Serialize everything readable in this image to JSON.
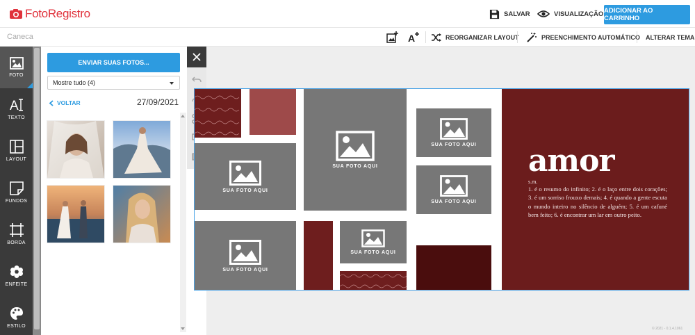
{
  "header": {
    "logo_text": "FotoRegistro",
    "save_label": "SALVAR",
    "preview_label": "VISUALIZAÇÃO",
    "cart_label": "ADICIONAR AO CARRINHO"
  },
  "subbar": {
    "product_name": "Caneca",
    "reorganize_label": "REORGANIZAR LAYOUT",
    "autofill_label": "PREENCHIMENTO AUTOMÁTICO",
    "change_theme_label": "ALTERAR TEMA"
  },
  "tools": [
    {
      "label": "FOTO",
      "icon": "image-icon",
      "active": true
    },
    {
      "label": "TEXTO",
      "icon": "text-icon"
    },
    {
      "label": "LAYOUT",
      "icon": "layout-icon"
    },
    {
      "label": "FUNDOS",
      "icon": "background-icon"
    },
    {
      "label": "BORDA",
      "icon": "border-icon"
    },
    {
      "label": "ENFEITE",
      "icon": "flower-icon"
    },
    {
      "label": "ESTILO",
      "icon": "palette-icon"
    }
  ],
  "panel": {
    "upload_label": "ENVIAR SUAS FOTOS...",
    "filter_value": "Mostre tudo (4)",
    "back_label": "VOLTAR",
    "date": "27/09/2021"
  },
  "photos": [
    {
      "name": "bride-veil"
    },
    {
      "name": "bride-dress-beach"
    },
    {
      "name": "couple-walking"
    },
    {
      "name": "woman-portrait"
    }
  ],
  "design": {
    "slot_label": "SUA FOTO AQUI",
    "title": "amor",
    "word_class": "s.m.",
    "definition": "1. é o resumo do infinito; 2. é o laço entre dois corações; 3. é um sorriso frouxo demais; 4. é quando a gente escuta o mundo inteiro no silêncio de alguém; 5. é um cafuné bem feito; 6. é encontrar um lar em outro peito.",
    "pattern_word": "love"
  },
  "colors": {
    "brand_red": "#e0323c",
    "accent_blue": "#2d9be0",
    "burgundy": "#6b1c1c",
    "rose": "#9e4a4a",
    "dark_red": "#4a0d0d",
    "placeholder_gray": "#777777"
  },
  "version": "© 2021 - 0.1.4.1061"
}
